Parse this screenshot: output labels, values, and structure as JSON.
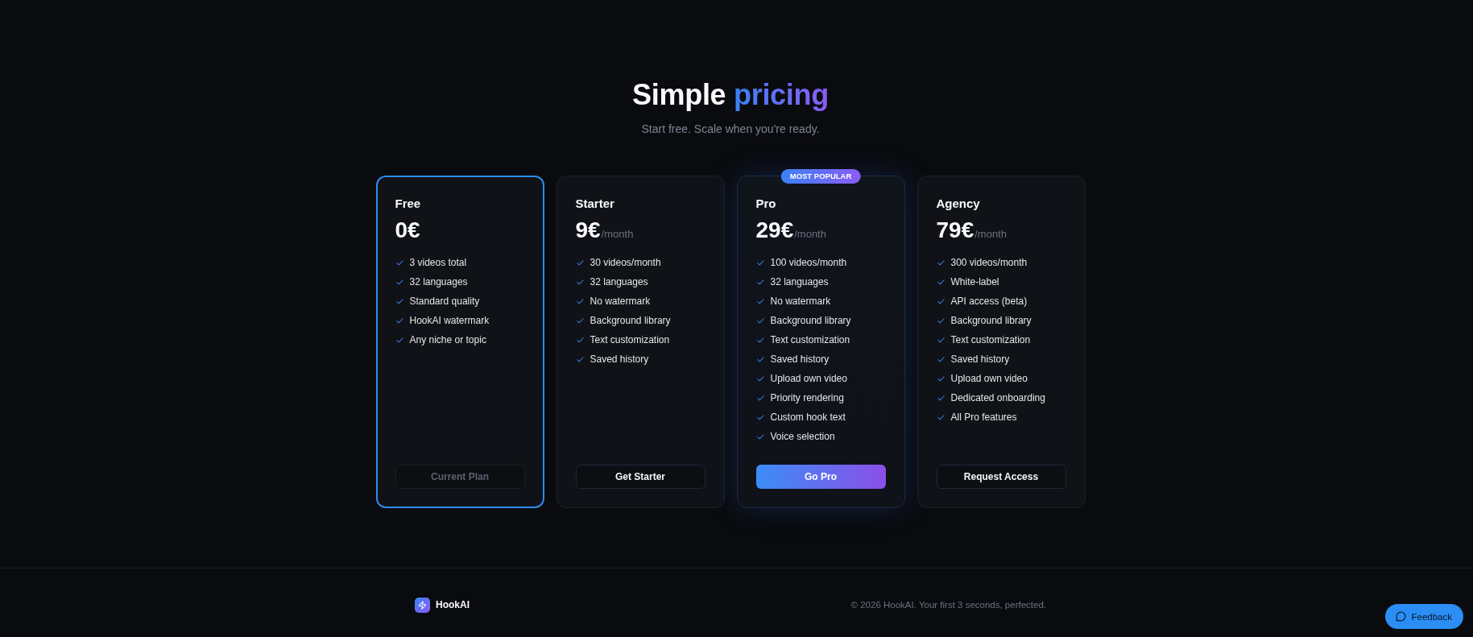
{
  "hero": {
    "title": "Simple",
    "title_highlight": "pricing",
    "subtitle": "Start free. Scale when you're ready."
  },
  "plans": [
    {
      "name": "Free",
      "price": "0€",
      "current": true,
      "featured": false,
      "features": [
        "3 videos total",
        "32 languages",
        "Standard quality",
        "HookAI watermark",
        "Any niche or topic"
      ],
      "button": {
        "label": "Current Plan",
        "kind": "outline",
        "disabled": true
      }
    },
    {
      "name": "Starter",
      "price": "9€",
      "period": "/month",
      "current": false,
      "featured": false,
      "features": [
        "30 videos/month",
        "32 languages",
        "No watermark",
        "Background library",
        "Text customization",
        "Saved history"
      ],
      "button": {
        "label": "Get Starter",
        "kind": "outline",
        "disabled": false
      }
    },
    {
      "name": "Pro",
      "badge": "MOST POPULAR",
      "price": "29€",
      "period": "/month",
      "current": false,
      "featured": true,
      "features": [
        "100 videos/month",
        "32 languages",
        "No watermark",
        "Background library",
        "Text customization",
        "Saved history",
        "Upload own video",
        "Priority rendering",
        "Custom hook text",
        "Voice selection"
      ],
      "button": {
        "label": "Go Pro",
        "kind": "gradient",
        "disabled": false
      }
    },
    {
      "name": "Agency",
      "price": "79€",
      "period": "/month",
      "current": false,
      "featured": false,
      "features": [
        "300 videos/month",
        "White-label",
        "API access (beta)",
        "Background library",
        "Text customization",
        "Saved history",
        "Upload own video",
        "Dedicated onboarding",
        "All Pro features"
      ],
      "button": {
        "label": "Request Access",
        "kind": "outline",
        "disabled": false
      }
    }
  ],
  "footer": {
    "brand": "HookAI",
    "copyright": "© 2026 HookAI. Your first 3 seconds, perfected."
  },
  "feedback_button": {
    "label": "Feedback"
  }
}
